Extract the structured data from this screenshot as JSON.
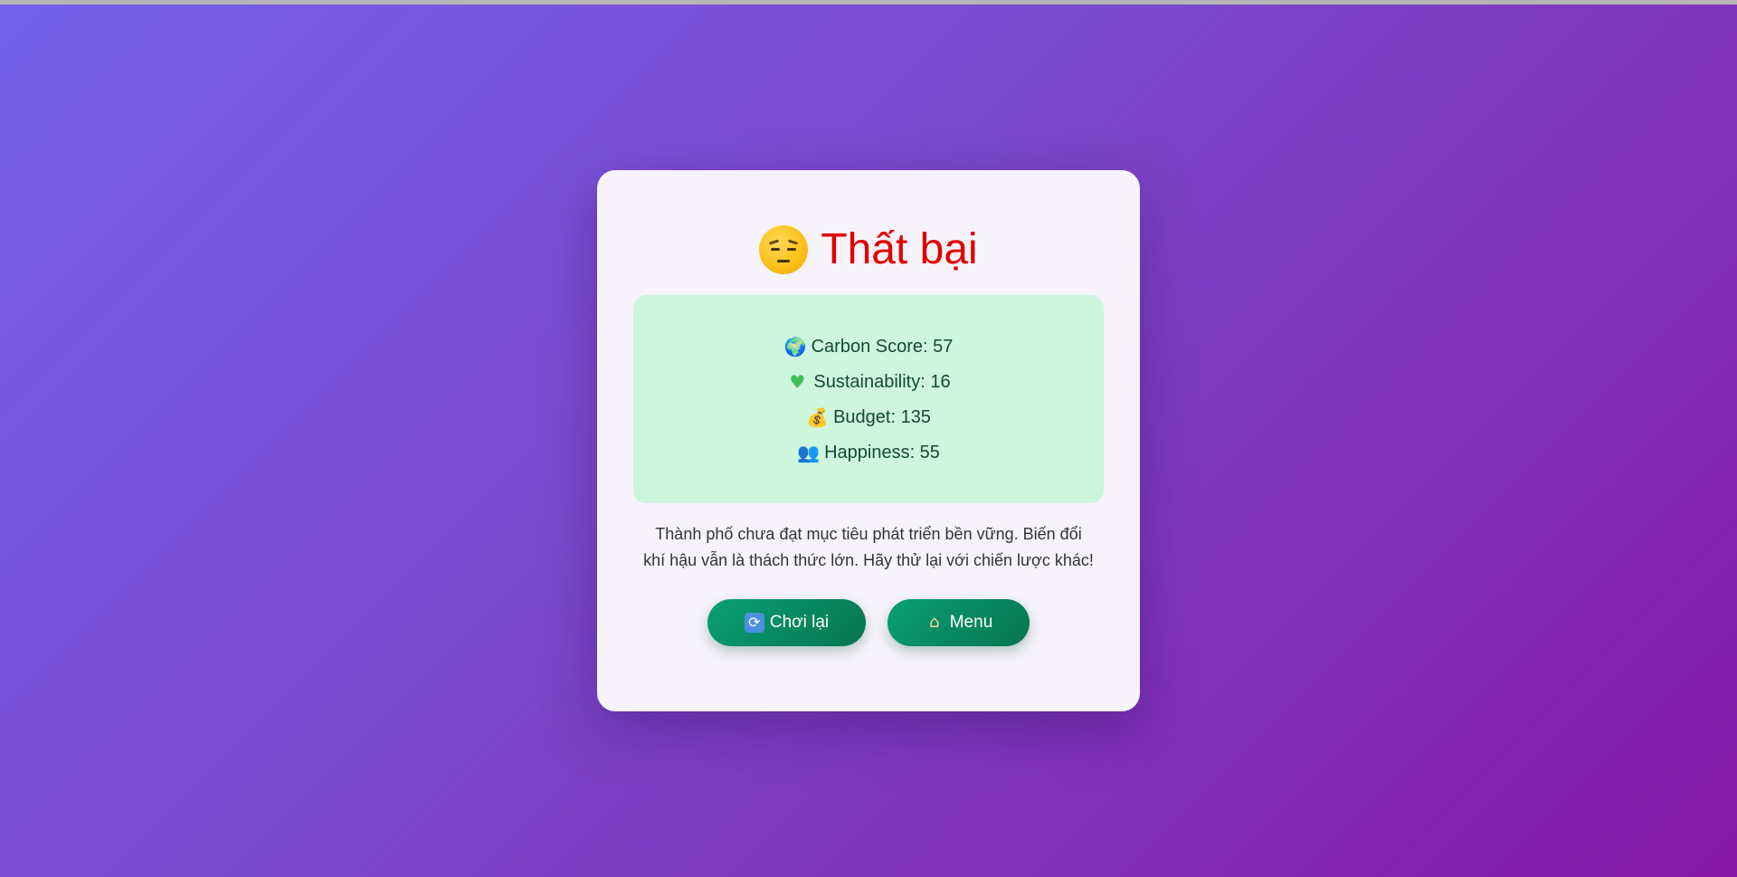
{
  "result": {
    "title": "Thất bại",
    "emoji_icon": "pensive-face-icon",
    "title_color": "#e00000"
  },
  "stats": [
    {
      "icon": "globe-icon",
      "glyph": "🌍",
      "text": "Carbon Score: 57"
    },
    {
      "icon": "green-heart-icon",
      "glyph": "♥",
      "text": "Sustainability: 16"
    },
    {
      "icon": "money-bag-icon",
      "glyph": "💰",
      "text": "Budget: 135"
    },
    {
      "icon": "people-icon",
      "glyph": "👥",
      "text": "Happiness: 55"
    }
  ],
  "message": "Thành phố chưa đạt mục tiêu phát triển bền vững. Biến đổi khí hậu vẫn là thách thức lớn. Hãy thử lại với chiến lược khác!",
  "buttons": {
    "replay_label": "Chơi lại",
    "replay_icon": "🔄",
    "menu_label": "Menu",
    "menu_icon": "🏠"
  },
  "colors": {
    "background_start": "#7461ea",
    "background_end": "#8619a6",
    "card": "#f7f3fb",
    "stats_panel": "#cdf6dd",
    "button": "#0b9f73"
  }
}
